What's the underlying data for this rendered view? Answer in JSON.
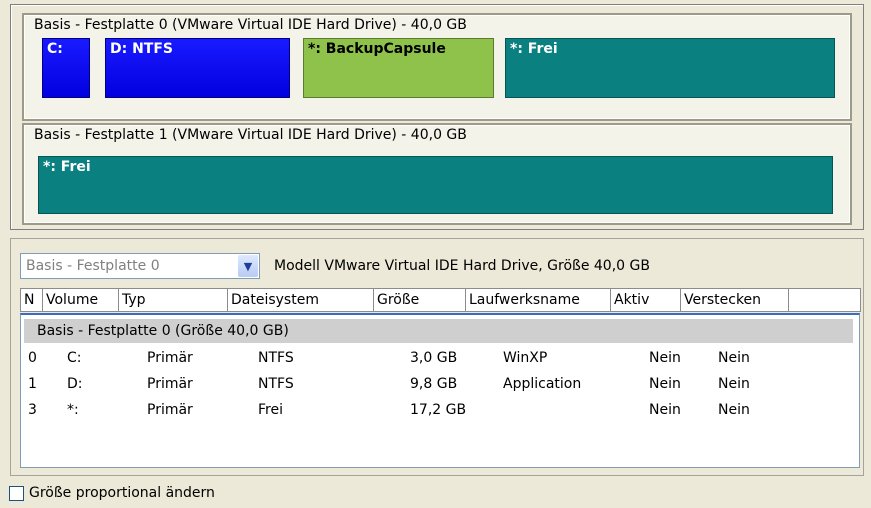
{
  "disk0": {
    "title": "Basis -  Festplatte 0 (VMware Virtual IDE Hard Drive) - 40,0 GB",
    "partitions": [
      {
        "label": "C:",
        "color": "#0000e8"
      },
      {
        "label": "D: NTFS",
        "color": "#0000e8"
      },
      {
        "label": "*: BackupCapsule",
        "color": "#8fc24a"
      },
      {
        "label": "*: Frei",
        "color": "#0b8080"
      }
    ]
  },
  "disk1": {
    "title": "Basis -  Festplatte 1 (VMware Virtual IDE Hard Drive) - 40,0 GB",
    "partitions": [
      {
        "label": "*: Frei",
        "color": "#0b8080"
      }
    ]
  },
  "selector": {
    "value": "Basis - Festplatte 0",
    "model_text": "Modell VMware Virtual IDE Hard Drive, Größe 40,0 GB"
  },
  "table": {
    "columns": [
      "N",
      "Volume",
      "Typ",
      "Dateisystem",
      "Größe",
      "Laufwerksname",
      "Aktiv",
      "Verstecken"
    ],
    "group_label": "Basis -  Festplatte 0 (Größe 40,0 GB)",
    "rows": [
      {
        "n": "0",
        "volume": "C:",
        "typ": "Primär",
        "fs": "NTFS",
        "size": "3,0 GB",
        "name": "WinXP",
        "aktiv": "Nein",
        "versteckt": "Nein"
      },
      {
        "n": "1",
        "volume": "D:",
        "typ": "Primär",
        "fs": "NTFS",
        "size": "9,8 GB",
        "name": "Application",
        "aktiv": "Nein",
        "versteckt": "Nein"
      },
      {
        "n": "3",
        "volume": "*:",
        "typ": "Primär",
        "fs": "Frei",
        "size": "17,2 GB",
        "name": "",
        "aktiv": "Nein",
        "versteckt": "Nein"
      }
    ]
  },
  "options": {
    "proportional_label": "Größe proportional ändern",
    "proportional_checked": false
  }
}
